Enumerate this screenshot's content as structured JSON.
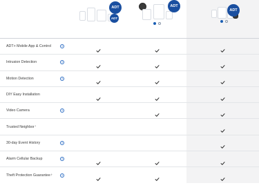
{
  "products": {
    "badge_text": "ADT",
    "carousel": {
      "dots_product2": [
        "inactive-dot",
        "active-dot"
      ],
      "dots_product3": [
        "active-dot",
        "inactive-dot"
      ]
    }
  },
  "features": [
    {
      "label": "ADT+ Mobile App & Control",
      "info": true,
      "p1": true,
      "p2": true,
      "p3": true
    },
    {
      "label": "Intrusion Detection",
      "info": true,
      "p1": true,
      "p2": true,
      "p3": true
    },
    {
      "label": "Motion Detection",
      "info": true,
      "p1": true,
      "p2": true,
      "p3": true
    },
    {
      "label": "DIY Easy Installation",
      "info": false,
      "p1": true,
      "p2": true,
      "p3": true
    },
    {
      "label": "Video Camera",
      "info": true,
      "p1": false,
      "p2": true,
      "p3": true
    },
    {
      "label": "Trusted Neighbor",
      "mark": "*",
      "info": false,
      "p1": false,
      "p2": false,
      "p3": true
    },
    {
      "label": "30-day Event History",
      "info": true,
      "p1": false,
      "p2": false,
      "p3": true
    },
    {
      "label": "Alarm Cellular Backup",
      "info": true,
      "p1": true,
      "p2": true,
      "p3": true
    },
    {
      "label": "Theft Protection Guarantee",
      "mark": "†",
      "info": true,
      "p1": true,
      "p2": true,
      "p3": true
    }
  ],
  "colors": {
    "accent": "#1a4fa0",
    "info": "#2f6fc4",
    "check": "#222222",
    "highlight_column": "#f3f3f4"
  },
  "icons": {
    "info": "info-circle-icon",
    "check": "checkmark-icon"
  }
}
